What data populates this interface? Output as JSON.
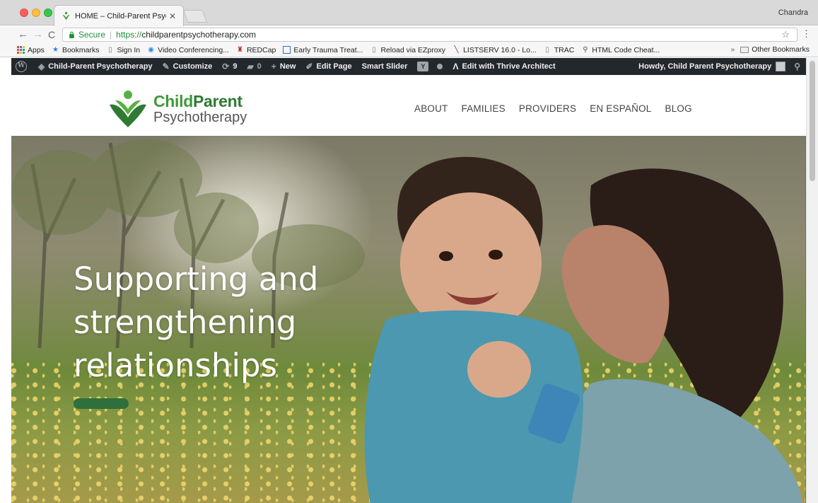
{
  "browser": {
    "tab_title": "HOME – Child-Parent Psychoth",
    "profile_name": "Chandra",
    "secure_label": "Secure",
    "url_scheme": "https://",
    "url_host": "childparentpsychotherapy.com"
  },
  "bookmarks": {
    "items": [
      {
        "label": "Apps",
        "icon": "apps-grid-icon"
      },
      {
        "label": "Bookmarks",
        "icon": "star-icon"
      },
      {
        "label": "Sign In",
        "icon": "page-icon"
      },
      {
        "label": "Video Conferencing...",
        "icon": "video-icon"
      },
      {
        "label": "REDCap",
        "icon": "redcap-icon"
      },
      {
        "label": "Early Trauma Treat...",
        "icon": "calendar-icon"
      },
      {
        "label": "Reload via EZproxy",
        "icon": "page-icon"
      },
      {
        "label": "LISTSERV 16.0 - Lo...",
        "icon": "listserv-icon"
      },
      {
        "label": "TRAC",
        "icon": "page-icon"
      },
      {
        "label": "HTML Code Cheat...",
        "icon": "html-icon"
      }
    ],
    "more": "»",
    "other": "Other Bookmarks"
  },
  "adminbar": {
    "site_name": "Child-Parent Psychotherapy",
    "customize": "Customize",
    "updates_count": "9",
    "comments_count": "0",
    "new_label": "New",
    "edit_page": "Edit Page",
    "smart_slider": "Smart Slider",
    "thrive": "Edit with Thrive Architect",
    "howdy": "Howdy, Child Parent Psychotherapy"
  },
  "site": {
    "logo_line1_a": "Child",
    "logo_line1_b": "Parent",
    "logo_line2": "Psychotherapy",
    "nav": [
      "ABOUT",
      "FAMILIES",
      "PROVIDERS",
      "EN ESPAÑOL",
      "BLOG"
    ]
  },
  "hero": {
    "line1": "Supporting and",
    "line2": "strengthening",
    "line3": "relationships"
  },
  "colors": {
    "brand_green": "#3e9a3a",
    "brand_dark_green": "#2f6f3b",
    "adminbar_bg": "#23282d"
  }
}
